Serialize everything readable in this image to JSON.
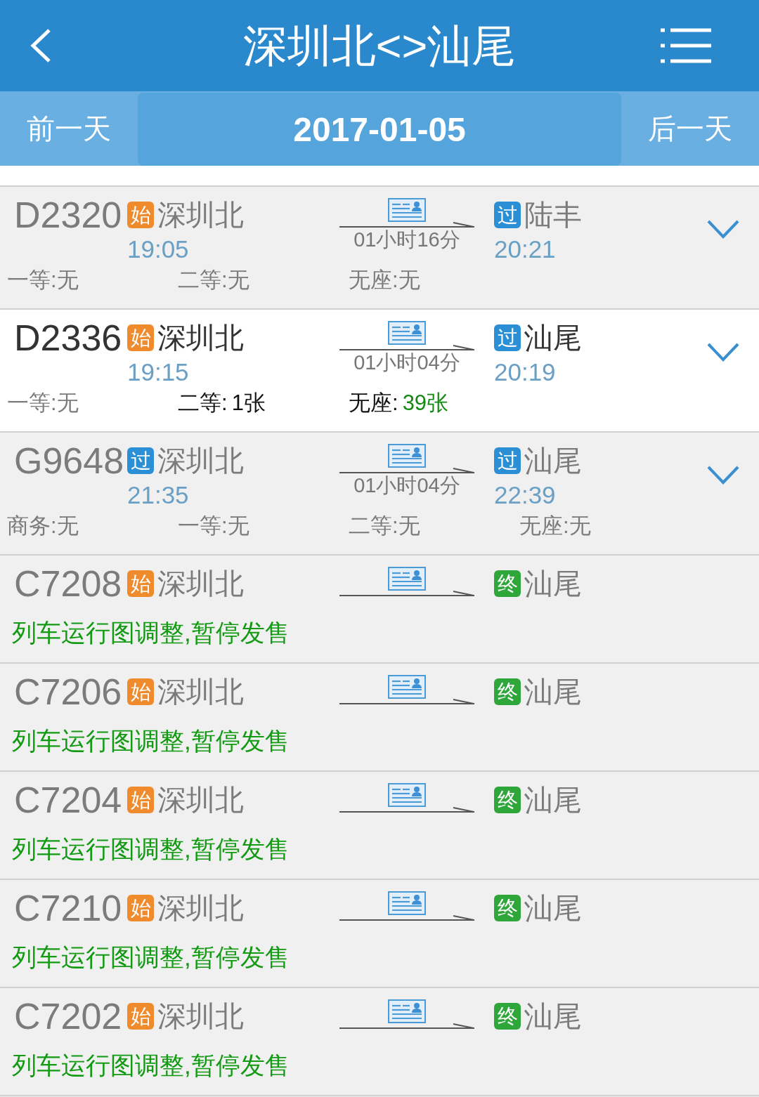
{
  "header": {
    "title": "深圳北<>汕尾"
  },
  "date_bar": {
    "prev": "前一天",
    "date": "2017-01-05",
    "next": "后一天"
  },
  "trains": [
    {
      "number": "D2320",
      "available": false,
      "expandable": true,
      "from": {
        "badge": "始",
        "kind": "start",
        "station": "深圳北",
        "time": "19:05"
      },
      "duration": "01小时16分",
      "to": {
        "badge": "过",
        "kind": "pass",
        "station": "陆丰",
        "time": "20:21"
      },
      "seats": [
        {
          "label": "一等:",
          "value": "无",
          "available": false,
          "plenty": false
        },
        {
          "label": "二等:",
          "value": "无",
          "available": false,
          "plenty": false
        },
        {
          "label": "无座:",
          "value": "无",
          "available": false,
          "plenty": false
        }
      ]
    },
    {
      "number": "D2336",
      "available": true,
      "expandable": true,
      "from": {
        "badge": "始",
        "kind": "start",
        "station": "深圳北",
        "time": "19:15"
      },
      "duration": "01小时04分",
      "to": {
        "badge": "过",
        "kind": "pass",
        "station": "汕尾",
        "time": "20:19"
      },
      "seats": [
        {
          "label": "一等:",
          "value": "无",
          "available": false,
          "plenty": false
        },
        {
          "label": "二等:",
          "value": "1张",
          "available": true,
          "plenty": false
        },
        {
          "label": "无座:",
          "value": "39张",
          "available": true,
          "plenty": true
        }
      ]
    },
    {
      "number": "G9648",
      "available": false,
      "expandable": true,
      "from": {
        "badge": "过",
        "kind": "pass",
        "station": "深圳北",
        "time": "21:35"
      },
      "duration": "01小时04分",
      "to": {
        "badge": "过",
        "kind": "pass",
        "station": "汕尾",
        "time": "22:39"
      },
      "seats": [
        {
          "label": "商务:",
          "value": "无",
          "available": false,
          "plenty": false
        },
        {
          "label": "一等:",
          "value": "无",
          "available": false,
          "plenty": false
        },
        {
          "label": "二等:",
          "value": "无",
          "available": false,
          "plenty": false
        },
        {
          "label": "无座:",
          "value": "无",
          "available": false,
          "plenty": false
        }
      ]
    },
    {
      "number": "C7208",
      "available": false,
      "expandable": false,
      "from": {
        "badge": "始",
        "kind": "start",
        "station": "深圳北"
      },
      "to": {
        "badge": "终",
        "kind": "end",
        "station": "汕尾"
      },
      "notice": "列车运行图调整,暂停发售"
    },
    {
      "number": "C7206",
      "available": false,
      "expandable": false,
      "from": {
        "badge": "始",
        "kind": "start",
        "station": "深圳北"
      },
      "to": {
        "badge": "终",
        "kind": "end",
        "station": "汕尾"
      },
      "notice": "列车运行图调整,暂停发售"
    },
    {
      "number": "C7204",
      "available": false,
      "expandable": false,
      "from": {
        "badge": "始",
        "kind": "start",
        "station": "深圳北"
      },
      "to": {
        "badge": "终",
        "kind": "end",
        "station": "汕尾"
      },
      "notice": "列车运行图调整,暂停发售"
    },
    {
      "number": "C7210",
      "available": false,
      "expandable": false,
      "from": {
        "badge": "始",
        "kind": "start",
        "station": "深圳北"
      },
      "to": {
        "badge": "终",
        "kind": "end",
        "station": "汕尾"
      },
      "notice": "列车运行图调整,暂停发售"
    },
    {
      "number": "C7202",
      "available": false,
      "expandable": false,
      "from": {
        "badge": "始",
        "kind": "start",
        "station": "深圳北"
      },
      "to": {
        "badge": "终",
        "kind": "end",
        "station": "汕尾"
      },
      "notice": "列车运行图调整,暂停发售"
    }
  ]
}
